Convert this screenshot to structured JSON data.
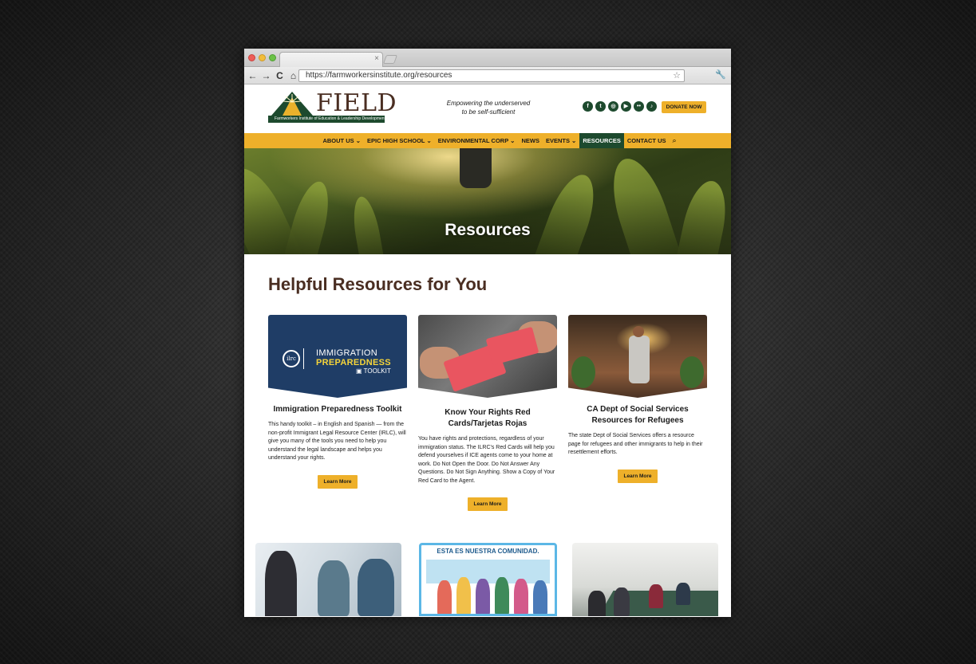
{
  "browser": {
    "url": "https://farmworkersinstitute.org/resources",
    "tab_close": "×",
    "back": "←",
    "forward": "→",
    "reload": "C",
    "home": "⌂",
    "star": "☆",
    "wrench": "🔧"
  },
  "header": {
    "logo_word": "FIELD",
    "logo_subtitle": "Farmworkers Institute of Education & Leadership Development",
    "tagline_line1": "Empowering the underserved",
    "tagline_line2": "to be self-sufficient",
    "socials": [
      "f",
      "t",
      "◎",
      "▶",
      "••",
      "♪"
    ],
    "donate_label": "DONATE NOW"
  },
  "nav": {
    "items": [
      {
        "label": "ABOUT US ⌄"
      },
      {
        "label": "EPIC HIGH SCHOOL ⌄"
      },
      {
        "label": "ENVIRONMENTAL CORP ⌄"
      },
      {
        "label": "NEWS"
      },
      {
        "label": "EVENTS ⌄"
      },
      {
        "label": "RESOURCES"
      },
      {
        "label": "CONTACT US"
      }
    ],
    "search_icon": "⌕"
  },
  "hero": {
    "title": "Resources"
  },
  "main": {
    "section_title": "Helpful Resources for You",
    "cards": [
      {
        "title": "Immigration Preparedness Toolkit",
        "body": "This handy toolkit – in English and Spanish — from the non-profit Immigrant Legal Resource Center (IRLC), will give you many of the tools you need to help you understand the legal landscape and helps you understand your rights.",
        "button": "Learn More",
        "image": {
          "seal": "ilrc",
          "line1": "IMMIGRATION",
          "line2": "PREPAREDNESS",
          "line3": "▣ TOOLKIT"
        }
      },
      {
        "title": "Know Your Rights Red Cards/Tarjetas Rojas",
        "body": "You have rights and protections, regardless of your immigration status. The ILRC's Red Cards will help you defend yourselves if ICE agents come to your home at work. Do Not Open the Door. Do Not Answer Any Questions. Do Not Sign Anything. Show a Copy of Your Red Card to the Agent.",
        "button": "Learn More"
      },
      {
        "title": "CA Dept of Social Services Resources for Refugees",
        "body": "The state Dept of Social Services offers a resource page for refugees and other immigrants to help in their resettlement efforts.",
        "button": "Learn More"
      }
    ],
    "community_banner": "ESTA ES NUESTRA COMUNIDAD."
  }
}
